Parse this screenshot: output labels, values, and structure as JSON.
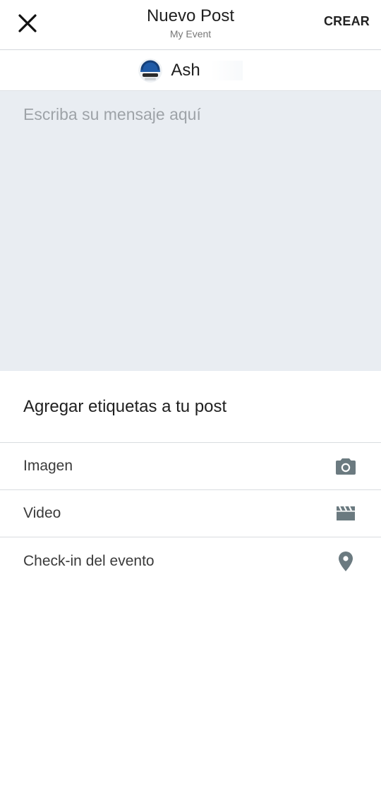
{
  "header": {
    "title": "Nuevo Post",
    "subtitle": "My Event",
    "create_label": "CREAR",
    "close_icon": "close-icon"
  },
  "author": {
    "name": "Ash",
    "avatar_icon": "astronaut-avatar-icon"
  },
  "composer": {
    "placeholder": "Escriba su mensaje aquí",
    "value": ""
  },
  "tags": {
    "heading": "Agregar etiquetas a tu post",
    "options": [
      {
        "label": "Imagen",
        "icon": "camera-icon"
      },
      {
        "label": "Video",
        "icon": "clapperboard-icon"
      },
      {
        "label": "Check-in del evento",
        "icon": "location-pin-icon"
      }
    ]
  },
  "colors": {
    "composer_background": "#e9edf2",
    "icon_color": "#6b7a80",
    "divider": "#d9dcdf"
  }
}
